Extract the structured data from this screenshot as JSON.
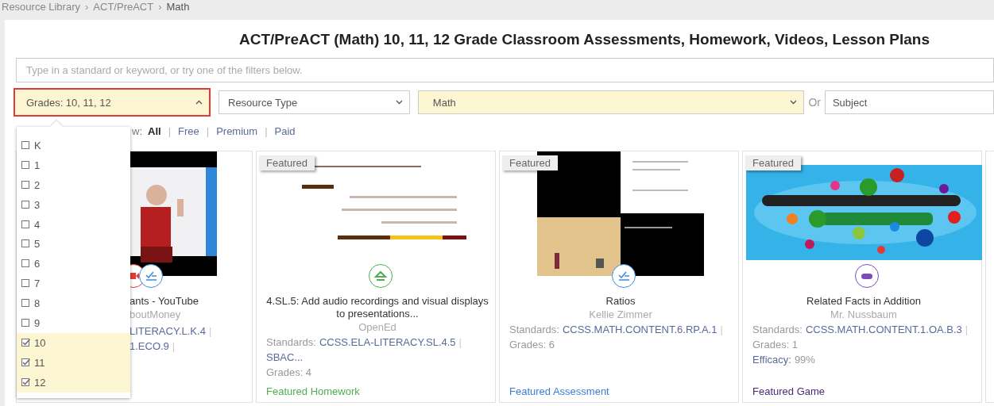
{
  "breadcrumb": {
    "separator": "›",
    "items": [
      {
        "label": "Resource Library",
        "current": false
      },
      {
        "label": "ACT/PreACT",
        "current": false
      },
      {
        "label": "Math",
        "current": true
      }
    ]
  },
  "title": "ACT/PreACT (Math) 10, 11, 12 Grade Classroom Assessments, Homework, Videos, Lesson Plans",
  "search": {
    "placeholder": "Type in a standard or keyword, or try one of the filters below."
  },
  "filters": {
    "grades": {
      "value": "Grades: 10, 11, 12",
      "expanded": true,
      "options": [
        {
          "label": "K",
          "checked": false
        },
        {
          "label": "1",
          "checked": false
        },
        {
          "label": "2",
          "checked": false
        },
        {
          "label": "3",
          "checked": false
        },
        {
          "label": "4",
          "checked": false
        },
        {
          "label": "5",
          "checked": false
        },
        {
          "label": "6",
          "checked": false
        },
        {
          "label": "7",
          "checked": false
        },
        {
          "label": "8",
          "checked": false
        },
        {
          "label": "9",
          "checked": false
        },
        {
          "label": "10",
          "checked": true
        },
        {
          "label": "11",
          "checked": true
        },
        {
          "label": "12",
          "checked": true
        }
      ]
    },
    "resource_type": {
      "placeholder": "Resource Type",
      "active": false
    },
    "subject_select": {
      "value": "Math",
      "active": true
    },
    "or_label": "Or",
    "subject_field": {
      "placeholder": "Subject"
    }
  },
  "show": {
    "label": "w:",
    "separator": "|",
    "options": [
      {
        "label": "All",
        "selected": true
      },
      {
        "label": "Free",
        "selected": false
      },
      {
        "label": "Premium",
        "selected": false
      },
      {
        "label": "Paid",
        "selected": false
      }
    ]
  },
  "cards": [
    {
      "kind": "covered",
      "thumbnail": {
        "kind": "picture"
      },
      "type_icons": [
        {
          "kind": "video"
        },
        {
          "kind": "assessment"
        }
      ],
      "title": "ants - YouTube",
      "source": "boutMoney",
      "standards": [
        {
          "text": "LITERACY.L.K.4",
          "kind": "code"
        },
        {
          "text": "|",
          "kind": "sep"
        },
        {
          "text": "1.ECO.9",
          "kind": "code"
        },
        {
          "text": "|",
          "kind": "sep"
        }
      ]
    },
    {
      "kind": "full",
      "featured_label": "Featured",
      "thumbnail": {
        "kind": "picture"
      },
      "type_icons": [
        {
          "kind": "homework"
        }
      ],
      "title": "4.SL.5: Add audio recordings and visual displays to presentations...",
      "source": "OpenEd",
      "standards_label": "Standards:",
      "standards": [
        {
          "text": "CCSS.ELA-LITERACY.SL.4.5",
          "kind": "code"
        },
        {
          "text": "|",
          "kind": "sep"
        },
        {
          "text": "SBAC...",
          "kind": "code"
        }
      ],
      "grades": "Grades: 4",
      "footer": {
        "label": "Featured Homework",
        "color": "#4caf50"
      }
    },
    {
      "kind": "full",
      "featured_label": "Featured",
      "thumbnail": {
        "kind": "picture"
      },
      "type_icons": [
        {
          "kind": "assessment"
        }
      ],
      "title": "Ratios",
      "source": "Kellie Zimmer",
      "standards_label": "Standards:",
      "standards": [
        {
          "text": "CCSS.MATH.CONTENT.6.RP.A.1",
          "kind": "code"
        },
        {
          "text": "|",
          "kind": "sep"
        }
      ],
      "grades": "Grades: 6",
      "footer": {
        "label": "Featured Assessment",
        "color": "#3b7dd8"
      }
    },
    {
      "kind": "full",
      "featured_label": "Featured",
      "thumbnail": {
        "kind": "picture"
      },
      "type_icons": [
        {
          "kind": "game"
        }
      ],
      "title": "Related Facts in Addition",
      "source": "Mr. Nussbaum",
      "standards_label": "Standards:",
      "standards": [
        {
          "text": "CCSS.MATH.CONTENT.1.OA.B.3",
          "kind": "code"
        },
        {
          "text": "|",
          "kind": "sep"
        }
      ],
      "grades": "Grades: 1",
      "efficacy": {
        "label": "Efficacy:",
        "value": "99%"
      },
      "footer": {
        "label": "Featured Game",
        "color": "#4b2a7b"
      }
    },
    {
      "kind": "edge"
    }
  ]
}
